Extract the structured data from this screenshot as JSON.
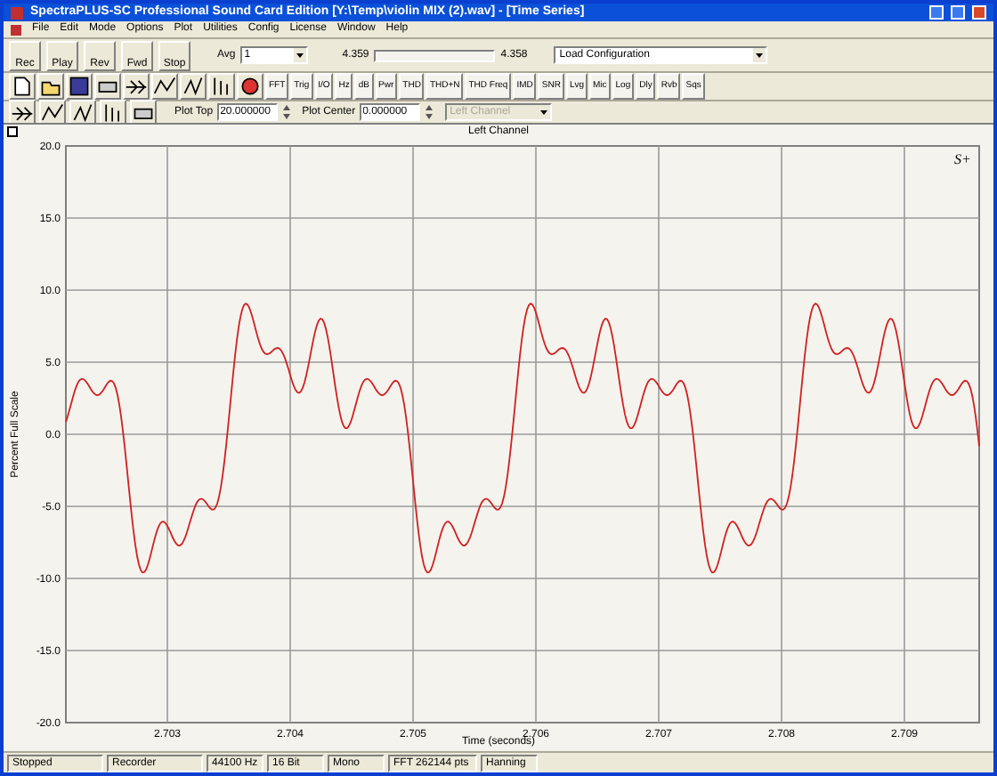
{
  "window": {
    "title": "SpectraPLUS-SC Professional Sound Card Edition [Y:\\Temp\\violin MIX (2).wav] - [Time Series]"
  },
  "menu": [
    "File",
    "Edit",
    "Mode",
    "Options",
    "Plot",
    "Utilities",
    "Config",
    "License",
    "Window",
    "Help"
  ],
  "transport": [
    {
      "label": "Rec"
    },
    {
      "label": "Play"
    },
    {
      "label": "Rev"
    },
    {
      "label": "Fwd"
    },
    {
      "label": "Stop"
    }
  ],
  "avg": {
    "label": "Avg",
    "value": "1"
  },
  "scroll_start": "4.359",
  "scroll_end": "4.358",
  "configuration": {
    "value": "Load Configuration"
  },
  "analysis_buttons": [
    {
      "label": "FFT"
    },
    {
      "label": "Trig"
    },
    {
      "label": "I/O"
    },
    {
      "label": "Hz"
    },
    {
      "label": "dB"
    },
    {
      "label": "Pwr"
    },
    {
      "label": "THD"
    },
    {
      "label": "THD+N"
    },
    {
      "label": "THD Freq"
    },
    {
      "label": "IMD"
    },
    {
      "label": "SNR"
    },
    {
      "label": "Lvg"
    },
    {
      "label": "Mic"
    },
    {
      "label": "Log"
    },
    {
      "label": "Dly"
    },
    {
      "label": "Rvb"
    },
    {
      "label": "Sqs"
    }
  ],
  "plot_top": {
    "label": "Plot Top",
    "value": "20.000000"
  },
  "plot_center": {
    "label": "Plot Center",
    "value": "0.000000"
  },
  "channel_select": {
    "value": "Left Channel",
    "disabled": true
  },
  "plot": {
    "title": "Left Channel",
    "logo": "S+",
    "ylabel": "Percent Full Scale",
    "xlabel": "Time (seconds)",
    "yticks": [
      "20.0",
      "15.0",
      "10.0",
      "5.0",
      "0.0",
      "-5.0",
      "-10.0",
      "-15.0",
      "-20.0"
    ],
    "xticks": [
      "2.703",
      "2.704",
      "2.705",
      "2.706",
      "2.707",
      "2.708",
      "2.709"
    ]
  },
  "status_bar": [
    "Stopped",
    "Recorder",
    "44100 Hz",
    "16 Bit",
    "Mono",
    "FFT 262144 pts",
    "Hanning"
  ]
}
